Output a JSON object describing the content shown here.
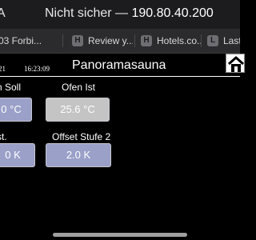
{
  "browser": {
    "lead_glyph": "A",
    "security": "Nicht sicher",
    "separator": "—",
    "host": "190.80.40.200"
  },
  "tabs": [
    {
      "icon": "",
      "label": "03 Forbi..."
    },
    {
      "icon": "H",
      "label": "Review y..."
    },
    {
      "icon": "H",
      "label": "Hotels.co..."
    },
    {
      "icon": "L",
      "label": "LastP"
    }
  ],
  "header": {
    "time_left": "21",
    "time_right": "16:23:09",
    "title": "Panoramasauna"
  },
  "fields": [
    {
      "label": "n Soll",
      "value": "0 °C"
    },
    {
      "label": "Ofen Ist",
      "value": "25.6 °C"
    },
    {
      "label": "st.",
      "value": "0 K"
    },
    {
      "label": "Offset Stufe 2",
      "value": "2.0 K"
    }
  ],
  "colors": {
    "button_blue": "#9aa0c8",
    "button_gray": "#c4c4c4",
    "background": "#000000"
  }
}
